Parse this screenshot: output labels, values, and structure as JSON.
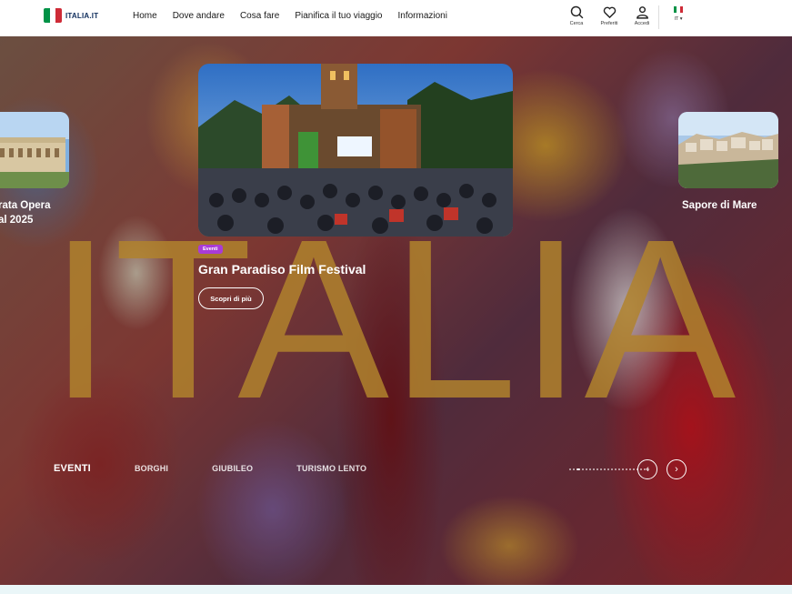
{
  "header": {
    "logo_text": "ITALIA.IT",
    "nav": [
      "Home",
      "Dove andare",
      "Cosa fare",
      "Pianifica il tuo viaggio",
      "Informazioni"
    ],
    "tools": {
      "search": "Cerca",
      "favorites": "Preferiti",
      "login": "Accedi"
    },
    "language": "IT"
  },
  "hero": {
    "big_word": "ITALIA",
    "left_card_title": "rata Opera\nal 2025",
    "right_card_title": "Sapore di Mare",
    "main_card": {
      "tag": "Eventi",
      "title": "Gran Paradiso Film Festival",
      "cta": "Scopri di più"
    },
    "categories": [
      "EVENTI",
      "BORGHI",
      "GIUBILEO",
      "TURISMO LENTO"
    ],
    "active_category": "EVENTI",
    "slides_total": 22,
    "active_slide": 3
  },
  "colors": {
    "flag_green": "#009246",
    "flag_white": "#ffffff",
    "flag_red": "#ce2b37",
    "tag_purple": "#a93bd6",
    "big_word_gold": "#b0822d",
    "brand_navy": "#0f2d5c"
  },
  "icons": [
    "search-icon",
    "heart-icon",
    "user-icon",
    "chevron-left-icon",
    "chevron-right-icon"
  ]
}
